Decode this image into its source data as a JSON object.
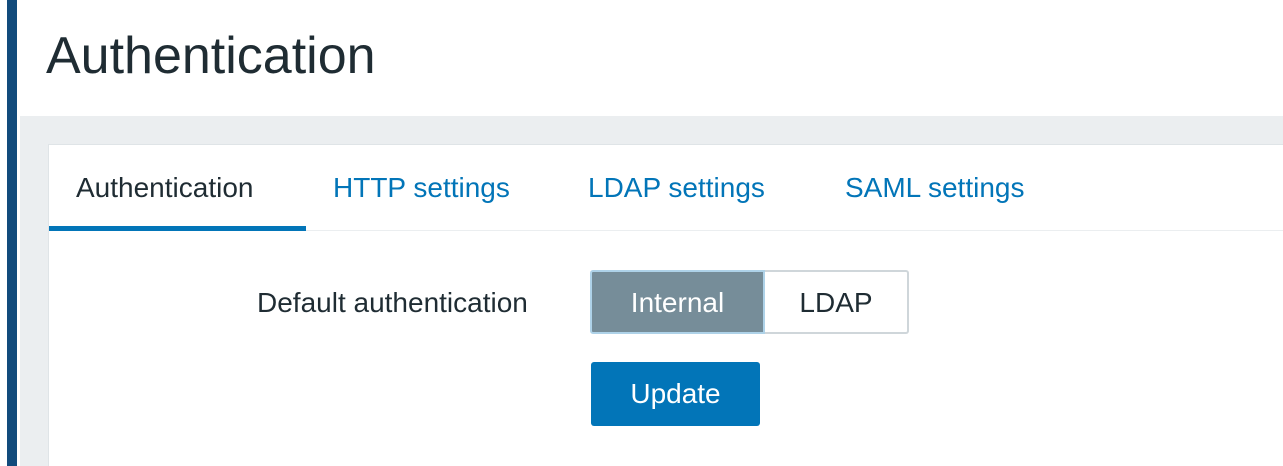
{
  "page": {
    "title": "Authentication"
  },
  "tabs": [
    {
      "label": "Authentication",
      "active": true
    },
    {
      "label": "HTTP settings",
      "active": false
    },
    {
      "label": "LDAP settings",
      "active": false
    },
    {
      "label": "SAML settings",
      "active": false
    }
  ],
  "form": {
    "default_auth_label": "Default authentication",
    "options": [
      {
        "label": "Internal",
        "selected": true
      },
      {
        "label": "LDAP",
        "selected": false
      }
    ],
    "update_label": "Update"
  },
  "colors": {
    "accent": "#0275b8",
    "sidebar": "#124b7c",
    "selected_option": "#768d99",
    "text": "#1f2c33"
  }
}
